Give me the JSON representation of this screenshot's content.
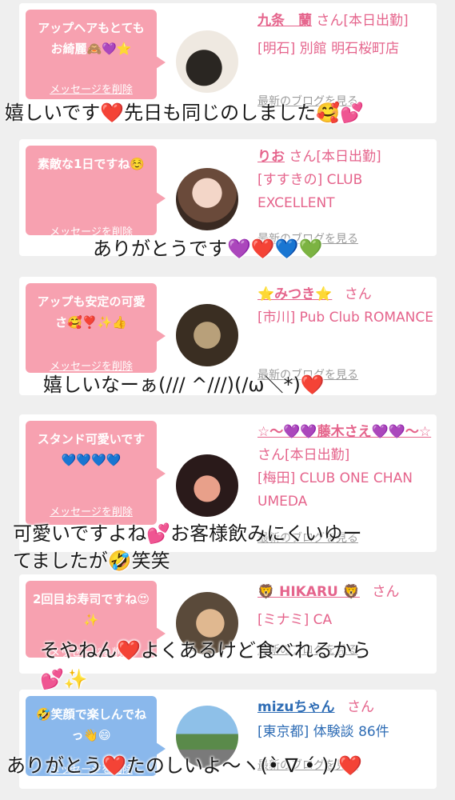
{
  "cards": [
    {
      "message": "アップヘアもとてもお綺麗🙈💜⭐️",
      "delete_label": "メッセージを削除",
      "name": "九条　蘭",
      "suffix": "さん[本日出勤]",
      "shop": "[明石] 別館 明石桜町店",
      "blog_label": "最新のブログを見る",
      "reply": "嬉しいです❤️先日も同じのしました🥰💕"
    },
    {
      "message": "素敵な1日ですね☺️",
      "delete_label": "メッセージを削除",
      "name": "りお",
      "suffix": "さん[本日出勤]",
      "shop": "[すすきの] CLUB EXCELLENT",
      "blog_label": "最新のブログを見る",
      "reply": "ありがとうです💜❤️💙💚"
    },
    {
      "message": "アップも安定の可愛さ🥰❣️✨👍",
      "delete_label": "メッセージを削除",
      "name": "⭐️みつき⭐️",
      "suffix": "さん",
      "shop": "[市川] Pub Club ROMANCE",
      "blog_label": "最新のブログを見る",
      "reply": "嬉しいなーぁ(/// ^///)(/ω＼*)❤️"
    },
    {
      "message": "スタンド可愛いです💙💙💙💙",
      "delete_label": "メッセージを削除",
      "name": "☆〜💜💜藤木さえ💜💜〜☆",
      "suffix": "さん[本日出勤]",
      "shop": "[梅田] CLUB ONE CHAN UMEDA",
      "blog_label": "最新のブログを見る",
      "reply_line1": "可愛いですよね💕お客様飲みにくいゆー",
      "reply_line2": "てましたが🤣笑笑"
    },
    {
      "message": "2回目お寿司ですね😍✨",
      "delete_label": "メッセージを削除",
      "name": "🦁 HIKARU 🦁",
      "suffix": "さん",
      "shop": "[ミナミ] CA",
      "blog_label": "最新のブログを見る",
      "reply_line1": "そやねん❤️よくあるけど食べれるから",
      "reply_line2": "💕✨"
    },
    {
      "message": "🤣笑顔で楽しんでねっ👋😄",
      "delete_label": "メッセージを削除",
      "name": "mizuちゃん",
      "suffix": "さん",
      "shop": "[東京都] 体験談 86件",
      "blog_label": "最新のブログを見る",
      "reply": "ありがとう❤️たのしいよ〜ヽ(•̀ ∇ •́ )ﾉ❤️"
    }
  ],
  "colors": {
    "pink_bubble": "#f7a1b0",
    "blue_bubble": "#8ab8ec",
    "name_pink": "#e5648c",
    "name_blue": "#2f6db5"
  }
}
